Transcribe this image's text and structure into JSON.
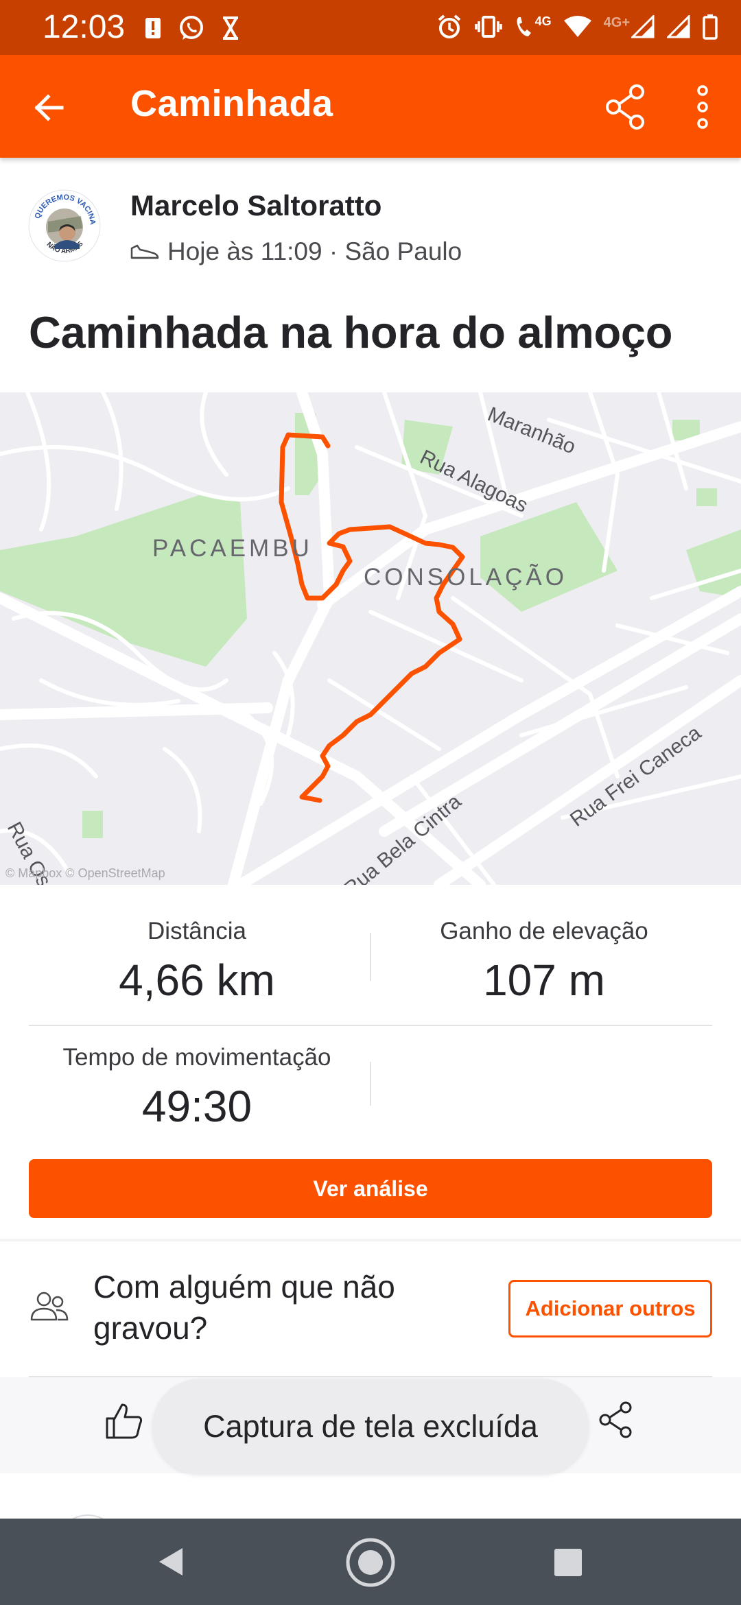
{
  "status_bar": {
    "time": "12:03",
    "network_4g": "4G",
    "network_4g_plus": "4G+",
    "icons": [
      "notification-icon",
      "whatsapp-icon",
      "hourglass-icon",
      "alarm-icon",
      "vibrate-icon",
      "volte-call-icon",
      "wifi-icon",
      "signal-icon",
      "signal-icon",
      "battery-icon"
    ]
  },
  "app_bar": {
    "title": "Caminhada",
    "icons": [
      "back-arrow-icon",
      "share-icon",
      "more-vert-icon"
    ]
  },
  "activity": {
    "athlete_name": "Marcelo Saltoratto",
    "avatar_text_top": "QUEREMOS VACINA",
    "avatar_text_bottom": "NÃO ARMAS",
    "meta": "Hoje às 11:09 · São Paulo",
    "sport_icon": "shoe-icon",
    "title": "Caminhada na hora do almoço"
  },
  "map": {
    "neighborhoods": [
      "PACAEMBU",
      "CONSOLAÇÃO"
    ],
    "streets": [
      "Maranhão",
      "Rua Alagoas",
      "Rua Frei Caneca",
      "Rua Bela Cintra",
      "Rua Oscar"
    ],
    "credit": "© Mapbox © OpenStreetMap",
    "route_color": "#fc5200",
    "park_color": "#c6e8bd"
  },
  "stats": {
    "distance": {
      "label": "Distância",
      "value": "4,66 km"
    },
    "elevation": {
      "label": "Ganho de elevação",
      "value": "107 m"
    },
    "moving_time": {
      "label": "Tempo de movimentação",
      "value": "49:30"
    }
  },
  "actions": {
    "analysis_button": "Ver análise",
    "others_prompt": "Com alguém que não gravou?",
    "add_others_button": "Adicionar outros"
  },
  "toast": {
    "message": "Captura de tela excluída"
  },
  "colors": {
    "brand": "#fc5200",
    "status_bar": "#c84000",
    "nav_bar": "#495057"
  }
}
